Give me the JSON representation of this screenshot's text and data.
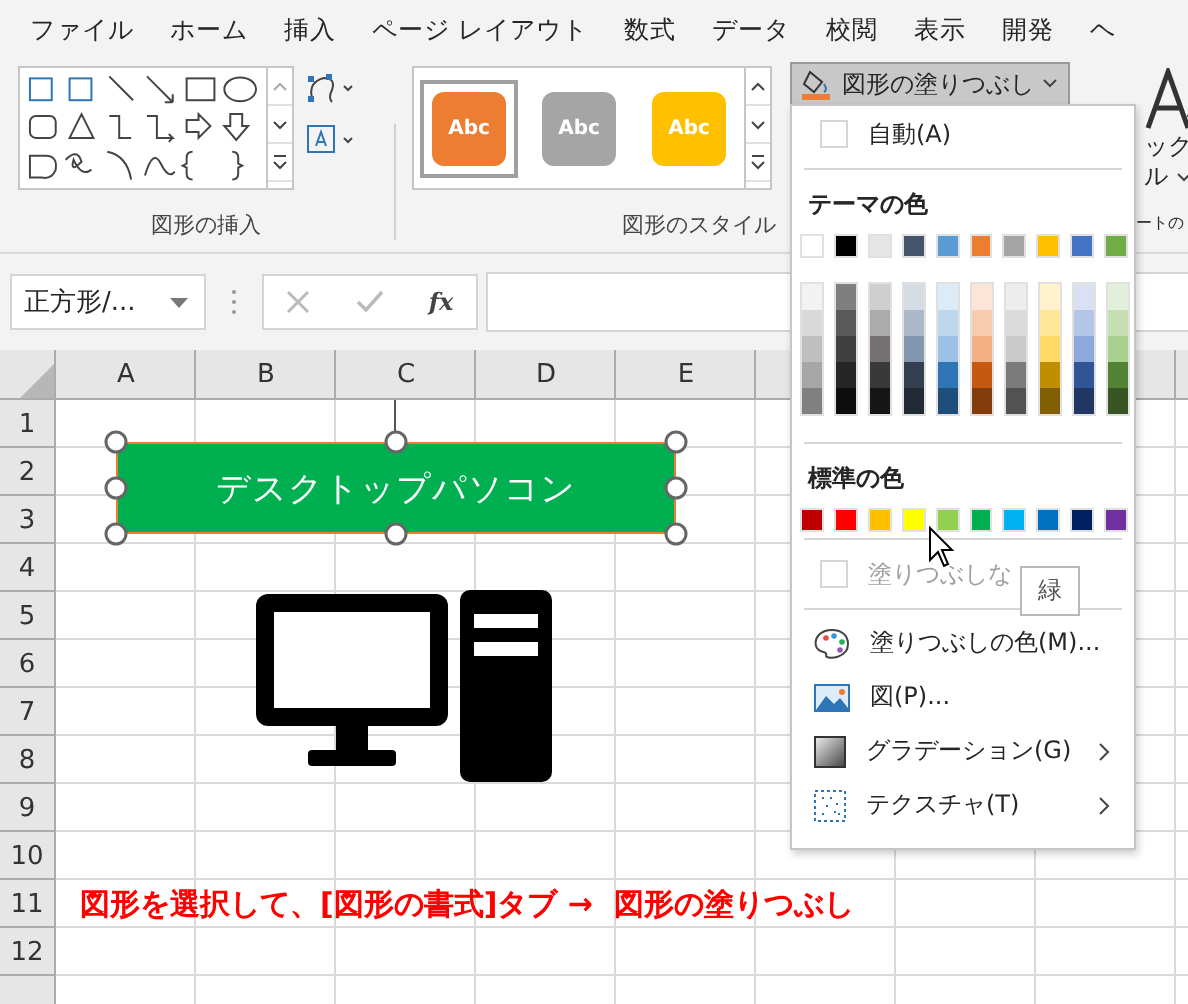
{
  "menu_tabs": [
    "ファイル",
    "ホーム",
    "挿入",
    "ページ レイアウト",
    "数式",
    "データ",
    "校閲",
    "表示",
    "開発",
    "ヘ"
  ],
  "ribbon": {
    "insert_group_label": "図形の挿入",
    "styles_group_label": "図形のスタイル",
    "style_presets": [
      {
        "label": "Abc",
        "color": "#ed7d31",
        "selected": true
      },
      {
        "label": "Abc",
        "color": "#a5a5a5",
        "selected": false
      },
      {
        "label": "Abc",
        "color": "#ffc000",
        "selected": false
      }
    ],
    "fill_button": {
      "label": "図形の塗りつぶし",
      "expanded": true
    },
    "partial_texts": [
      "ック",
      "ル",
      "ートの"
    ]
  },
  "formula_bar": {
    "name_box": "正方形/...",
    "function_label": "fx"
  },
  "sheet": {
    "columns": [
      "A",
      "B",
      "C",
      "D",
      "E"
    ],
    "rows": [
      "1",
      "2",
      "3",
      "4",
      "5",
      "6",
      "7",
      "8",
      "9",
      "10",
      "11",
      "12"
    ],
    "shape_text": "デスクトップパソコン",
    "note": "図形を選択して、[図形の書式]タブ →  図形の塗りつぶし"
  },
  "fill_menu": {
    "auto": "自動(A)",
    "theme_heading": "テーマの色",
    "theme_colors": [
      {
        "color": "#ffffff"
      },
      {
        "color": "#000000"
      },
      {
        "color": "#e7e6e6"
      },
      {
        "color": "#44546a"
      },
      {
        "color": "#5b9bd5"
      },
      {
        "color": "#ed7d31"
      },
      {
        "color": "#a5a5a5"
      },
      {
        "color": "#ffc000"
      },
      {
        "color": "#4472c4"
      },
      {
        "color": "#70ad47"
      }
    ],
    "theme_shades": [
      [
        {
          "color": "#f2f2f2"
        },
        {
          "color": "#d9d9d9"
        },
        {
          "color": "#bfbfbf"
        },
        {
          "color": "#a6a6a6"
        },
        {
          "color": "#808080"
        }
      ],
      [
        {
          "color": "#7f7f7f"
        },
        {
          "color": "#595959"
        },
        {
          "color": "#404040"
        },
        {
          "color": "#262626"
        },
        {
          "color": "#0d0d0d"
        }
      ],
      [
        {
          "color": "#d0cece"
        },
        {
          "color": "#aeabab"
        },
        {
          "color": "#757171"
        },
        {
          "color": "#3a3838"
        },
        {
          "color": "#171616"
        }
      ],
      [
        {
          "color": "#d6dce4"
        },
        {
          "color": "#adb9ca"
        },
        {
          "color": "#8497b0"
        },
        {
          "color": "#333f4f"
        },
        {
          "color": "#222b35"
        }
      ],
      [
        {
          "color": "#ddebf7"
        },
        {
          "color": "#bdd7ee"
        },
        {
          "color": "#9bc2e6"
        },
        {
          "color": "#2f75b5"
        },
        {
          "color": "#1f4e78"
        }
      ],
      [
        {
          "color": "#fce4d6"
        },
        {
          "color": "#f8cbad"
        },
        {
          "color": "#f4b084"
        },
        {
          "color": "#c65911"
        },
        {
          "color": "#833c0c"
        }
      ],
      [
        {
          "color": "#ededed"
        },
        {
          "color": "#dbdbdb"
        },
        {
          "color": "#c9c9c9"
        },
        {
          "color": "#7b7b7b"
        },
        {
          "color": "#525252"
        }
      ],
      [
        {
          "color": "#fff2cc"
        },
        {
          "color": "#ffe699"
        },
        {
          "color": "#ffd966"
        },
        {
          "color": "#bf8f00"
        },
        {
          "color": "#806000"
        }
      ],
      [
        {
          "color": "#d9e1f2"
        },
        {
          "color": "#b4c6e7"
        },
        {
          "color": "#8ea9db"
        },
        {
          "color": "#305496"
        },
        {
          "color": "#203764"
        }
      ],
      [
        {
          "color": "#e2efda"
        },
        {
          "color": "#c6e0b4"
        },
        {
          "color": "#a9d08e"
        },
        {
          "color": "#548235"
        },
        {
          "color": "#375623"
        }
      ]
    ],
    "standard_heading": "標準の色",
    "standard_colors": [
      {
        "color": "#c00000"
      },
      {
        "color": "#ff0000"
      },
      {
        "color": "#ffc000"
      },
      {
        "color": "#ffff00"
      },
      {
        "color": "#92d050"
      },
      {
        "color": "#00b050"
      },
      {
        "color": "#00b0f0"
      },
      {
        "color": "#0070c0"
      },
      {
        "color": "#002060"
      },
      {
        "color": "#7030a0"
      }
    ],
    "no_fill": "塗りつぶしな",
    "tooltip": "緑",
    "items": [
      {
        "kind": "palette",
        "label": "塗りつぶしの色(M)...",
        "submenu": false
      },
      {
        "kind": "picture",
        "label": "図(P)...",
        "submenu": false
      },
      {
        "kind": "gradient",
        "label": "グラデーション(G)",
        "submenu": true
      },
      {
        "kind": "texture",
        "label": "テクスチャ(T)",
        "submenu": true
      }
    ]
  }
}
